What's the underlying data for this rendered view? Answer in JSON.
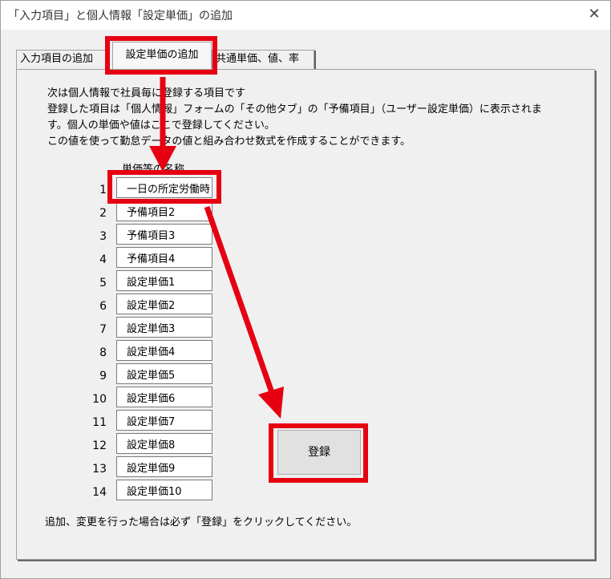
{
  "window": {
    "title": "「入力項目」と個人情報「設定単価」の追加",
    "close_glyph": "✕"
  },
  "tabs": [
    {
      "label": "入力項目の追加"
    },
    {
      "label": "設定単価の追加"
    },
    {
      "label": "共通単価、値、率"
    }
  ],
  "description": {
    "line1": "次は個人情報で社員毎に登録する項目です",
    "line2": "登録した項目は「個人情報」フォームの「その他タブ」の「予備項目」（ユーザー設定単価）に表示されま",
    "line3": "す。個人の単価や値はここで登録してください。",
    "line4": "この値を使って勤怠データの値と組み合わせ数式を作成することができます。"
  },
  "column_header": "単価等の名称",
  "rows": [
    {
      "num": "1",
      "value": "一日の所定労働時"
    },
    {
      "num": "2",
      "value": "予備項目2"
    },
    {
      "num": "3",
      "value": "予備項目3"
    },
    {
      "num": "4",
      "value": "予備項目4"
    },
    {
      "num": "5",
      "value": "設定単価1"
    },
    {
      "num": "6",
      "value": "設定単価2"
    },
    {
      "num": "7",
      "value": "設定単価3"
    },
    {
      "num": "8",
      "value": "設定単価4"
    },
    {
      "num": "9",
      "value": "設定単価5"
    },
    {
      "num": "10",
      "value": "設定単価6"
    },
    {
      "num": "11",
      "value": "設定単価7"
    },
    {
      "num": "12",
      "value": "設定単価8"
    },
    {
      "num": "13",
      "value": "設定単価9"
    },
    {
      "num": "14",
      "value": "設定単価10"
    }
  ],
  "register_button": "登録",
  "footer_note": "追加、変更を行った場合は必ず「登録」をクリックしてください。",
  "colors": {
    "highlight": "#e60012",
    "window_bg": "#f0f0f0"
  }
}
